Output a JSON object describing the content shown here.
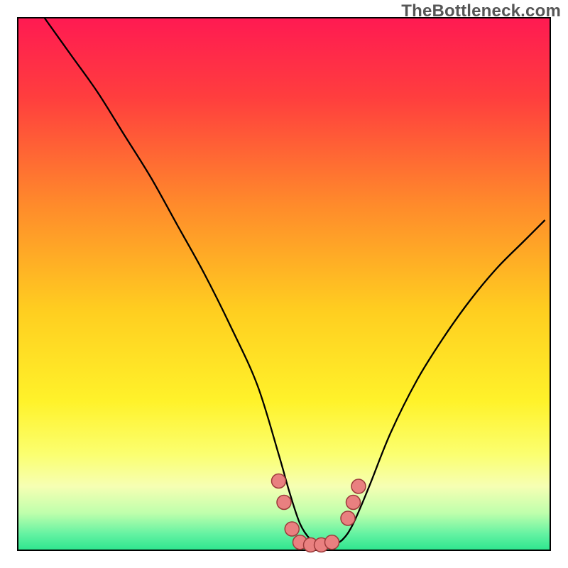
{
  "attribution": "TheBottleneck.com",
  "chart_data": {
    "type": "line",
    "title": "",
    "xlabel": "",
    "ylabel": "",
    "xlim": [
      0,
      100
    ],
    "ylim": [
      0,
      100
    ],
    "grid": false,
    "valley_x": 55,
    "series": [
      {
        "name": "curve",
        "color": "#000000",
        "x": [
          5,
          10,
          15,
          20,
          25,
          30,
          35,
          40,
          45,
          49,
          51,
          53,
          55,
          57,
          59,
          61,
          63,
          66,
          70,
          75,
          80,
          85,
          90,
          95,
          99
        ],
        "y": [
          100,
          93,
          86,
          78,
          70,
          61,
          52,
          42,
          31,
          18,
          11,
          5,
          2,
          1,
          1,
          2,
          5,
          12,
          22,
          32,
          40,
          47,
          53,
          58,
          62
        ]
      }
    ],
    "markers": [
      {
        "x": 49.0,
        "y": 13.0
      },
      {
        "x": 50.0,
        "y": 9.0
      },
      {
        "x": 51.5,
        "y": 4.0
      },
      {
        "x": 53.0,
        "y": 1.5
      },
      {
        "x": 55.0,
        "y": 1.0
      },
      {
        "x": 57.0,
        "y": 1.0
      },
      {
        "x": 59.0,
        "y": 1.5
      },
      {
        "x": 62.0,
        "y": 6.0
      },
      {
        "x": 63.0,
        "y": 9.0
      },
      {
        "x": 64.0,
        "y": 12.0
      }
    ],
    "background": {
      "type": "vertical-gradient",
      "stops": [
        {
          "offset": 0.0,
          "color": "#ff1a52"
        },
        {
          "offset": 0.15,
          "color": "#ff3e3e"
        },
        {
          "offset": 0.35,
          "color": "#ff8a2b"
        },
        {
          "offset": 0.55,
          "color": "#ffce20"
        },
        {
          "offset": 0.72,
          "color": "#fff22a"
        },
        {
          "offset": 0.82,
          "color": "#fbff70"
        },
        {
          "offset": 0.88,
          "color": "#f6ffb3"
        },
        {
          "offset": 0.93,
          "color": "#bfffac"
        },
        {
          "offset": 0.97,
          "color": "#63f2a2"
        },
        {
          "offset": 1.0,
          "color": "#2de58e"
        }
      ]
    },
    "frame": {
      "color": "#000000",
      "margin": 25
    }
  },
  "marker_style": {
    "fill": "#e98080",
    "stroke": "#9c3a3a",
    "r": 10
  }
}
